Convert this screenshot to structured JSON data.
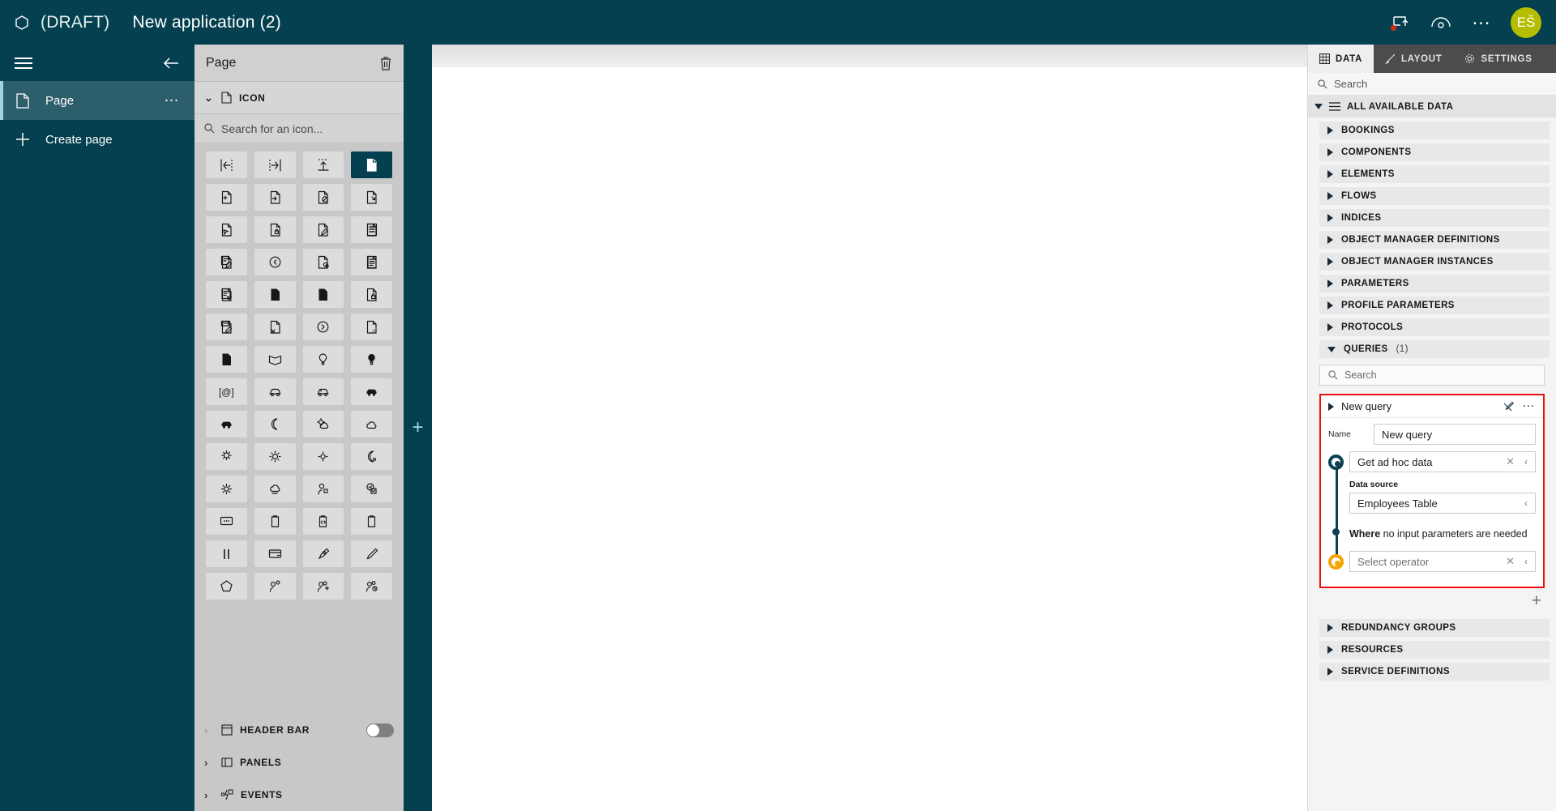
{
  "topbar": {
    "logo_icon": "hexagon-logo-icon",
    "draft_label": "(DRAFT)",
    "app_title": "New application (2)",
    "actions": [
      {
        "name": "publish-icon",
        "label": ""
      },
      {
        "name": "preview-eye-icon",
        "label": ""
      },
      {
        "name": "overflow-menu-icon",
        "label": "…"
      }
    ],
    "avatar_initials": "EŠ",
    "avatar_color": "#b5bd00",
    "background_color": "#04404f"
  },
  "sidebar": {
    "menu_icon": "hamburger-menu-icon",
    "back_icon": "back-arrow-icon",
    "items": [
      {
        "label": "Page",
        "icon": "document-icon",
        "selected": true,
        "more": "…"
      },
      {
        "label": "Create page",
        "icon": "plus-icon",
        "selected": false,
        "more": ""
      }
    ]
  },
  "panel2": {
    "title": "Page",
    "delete_icon": "trash-icon",
    "icon_section": {
      "label": "ICON",
      "icon": "document-icon",
      "expanded": true
    },
    "icon_search_placeholder": "Search for an icon...",
    "icons": [
      {
        "name": "align-left-icon",
        "glyph": "⋮←",
        "selected": false
      },
      {
        "name": "align-right-icon",
        "glyph": "→⋮",
        "selected": false
      },
      {
        "name": "align-top-icon",
        "glyph": "⤒",
        "selected": false
      },
      {
        "name": "document-icon",
        "glyph": "὜b",
        "selected": true
      },
      {
        "name": "document-add-icon",
        "glyph": "⊕",
        "selected": false
      },
      {
        "name": "document-forward-icon",
        "glyph": "→",
        "selected": false
      },
      {
        "name": "document-blocked-icon",
        "glyph": "⊘",
        "selected": false
      },
      {
        "name": "document-down-icon",
        "glyph": "↘",
        "selected": false
      },
      {
        "name": "document-cursor-icon",
        "glyph": "↖",
        "selected": false
      },
      {
        "name": "document-lock-icon",
        "glyph": "⚿",
        "selected": false
      },
      {
        "name": "document-edit-icon",
        "glyph": "✎",
        "selected": false
      },
      {
        "name": "document-list-icon",
        "glyph": "☰",
        "selected": false
      },
      {
        "name": "document-note-edit-icon",
        "glyph": "✏",
        "selected": false
      },
      {
        "name": "clock-back-icon",
        "glyph": "↺",
        "selected": false
      },
      {
        "name": "document-link-icon",
        "glyph": "⚭",
        "selected": false
      },
      {
        "name": "document-lines-icon",
        "glyph": "≡",
        "selected": false
      },
      {
        "name": "document-filter-icon",
        "glyph": "∇",
        "selected": false
      },
      {
        "name": "document-solid-lines-icon",
        "glyph": "▤",
        "selected": false
      },
      {
        "name": "document-filled-icon",
        "glyph": "▥",
        "selected": false
      },
      {
        "name": "document-lock2-icon",
        "glyph": "⚿",
        "selected": false
      },
      {
        "name": "document-pen-icon",
        "glyph": "✐",
        "selected": false
      },
      {
        "name": "document-close-icon",
        "glyph": "✕",
        "selected": false
      },
      {
        "name": "chevron-circle-right-icon",
        "glyph": "▶",
        "selected": false
      },
      {
        "name": "document-text-icon",
        "glyph": "A",
        "selected": false
      },
      {
        "name": "document-solid-icon",
        "glyph": "▮",
        "selected": false
      },
      {
        "name": "banner-icon",
        "glyph": "⬡",
        "selected": false
      },
      {
        "name": "balloon-icon",
        "glyph": "○",
        "selected": false
      },
      {
        "name": "balloon-filled-icon",
        "glyph": "●",
        "selected": false
      },
      {
        "name": "at-bracket-icon",
        "glyph": "[@]",
        "selected": false
      },
      {
        "name": "car-outline-icon",
        "glyph": "▱",
        "selected": false
      },
      {
        "name": "car-icon",
        "glyph": "▱",
        "selected": false
      },
      {
        "name": "car-filled-icon",
        "glyph": "▬",
        "selected": false
      },
      {
        "name": "car-solid-icon",
        "glyph": "▬",
        "selected": false
      },
      {
        "name": "moon-icon",
        "glyph": "☽",
        "selected": false
      },
      {
        "name": "sun-cloud-icon",
        "glyph": "⛅",
        "selected": false
      },
      {
        "name": "cloud-moon-icon",
        "glyph": "☁",
        "selected": false
      },
      {
        "name": "sun-rain-icon",
        "glyph": "☀",
        "selected": false
      },
      {
        "name": "sun-bright-icon",
        "glyph": "☀",
        "selected": false
      },
      {
        "name": "sun-small-icon",
        "glyph": "☀",
        "selected": false
      },
      {
        "name": "moon-crescent-icon",
        "glyph": "☾",
        "selected": false
      },
      {
        "name": "sun-rays-icon",
        "glyph": "☀",
        "selected": false
      },
      {
        "name": "cloud-wind-icon",
        "glyph": "☁",
        "selected": false
      },
      {
        "name": "person-lock-icon",
        "glyph": "☺",
        "selected": false
      },
      {
        "name": "check-badges-icon",
        "glyph": "✓",
        "selected": false
      },
      {
        "name": "chat-dots-icon",
        "glyph": "…",
        "selected": false
      },
      {
        "name": "clipboard-icon",
        "glyph": "Ὄb",
        "selected": false
      },
      {
        "name": "clipboard-code-icon",
        "glyph": "</>",
        "selected": false
      },
      {
        "name": "clipboard-text-icon",
        "glyph": "A",
        "selected": false
      },
      {
        "name": "pause-icon",
        "glyph": "‖",
        "selected": false
      },
      {
        "name": "credit-card-icon",
        "glyph": "▭",
        "selected": false
      },
      {
        "name": "pen-nib-icon",
        "glyph": "✒",
        "selected": false
      },
      {
        "name": "pencil-icon",
        "glyph": "✎",
        "selected": false
      },
      {
        "name": "pentagon-icon",
        "glyph": "⬠",
        "selected": false
      },
      {
        "name": "person-add-small-icon",
        "glyph": "☺",
        "selected": false
      },
      {
        "name": "people-add-icon",
        "glyph": "☺",
        "selected": false
      },
      {
        "name": "people-time-icon",
        "glyph": "☺",
        "selected": false
      }
    ],
    "sections": [
      {
        "label": "HEADER BAR",
        "icon": "header-bar-icon",
        "expanded": false,
        "has_toggle": true,
        "toggle_on": false
      },
      {
        "label": "PANELS",
        "icon": "panels-icon",
        "expanded": false,
        "has_toggle": false,
        "toggle_on": false
      },
      {
        "label": "EVENTS",
        "icon": "events-icon",
        "expanded": false,
        "has_toggle": false,
        "toggle_on": false
      }
    ]
  },
  "strip": {
    "add_label": "+"
  },
  "right_panel": {
    "tabs": [
      {
        "label": "DATA",
        "icon": "table-icon",
        "active": true
      },
      {
        "label": "LAYOUT",
        "icon": "brush-icon",
        "active": false
      },
      {
        "label": "SETTINGS",
        "icon": "gear-icon",
        "active": false
      }
    ],
    "search_placeholder": "Search",
    "all_data_label": "ALL AVAILABLE DATA",
    "all_data_icon": "list-icon",
    "categories_before": [
      {
        "label": "BOOKINGS",
        "count": ""
      },
      {
        "label": "COMPONENTS",
        "count": ""
      },
      {
        "label": "ELEMENTS",
        "count": ""
      },
      {
        "label": "FLOWS",
        "count": ""
      },
      {
        "label": "INDICES",
        "count": ""
      },
      {
        "label": "OBJECT MANAGER DEFINITIONS",
        "count": ""
      },
      {
        "label": "OBJECT MANAGER INSTANCES",
        "count": ""
      },
      {
        "label": "PARAMETERS",
        "count": ""
      },
      {
        "label": "PROFILE PARAMETERS",
        "count": ""
      },
      {
        "label": "PROTOCOLS",
        "count": ""
      }
    ],
    "queries_section": {
      "label": "QUERIES",
      "count": "(1)",
      "expanded": true,
      "search_placeholder": "Search",
      "card": {
        "title": "New query",
        "disconnect_icon": "unlink-pen-icon",
        "more_icon": "overflow-menu-icon",
        "name_label": "Name",
        "name_value": "New query",
        "action_value": "Get ad hoc data",
        "data_source_label": "Data source",
        "data_source_value": "Employees Table",
        "where_bold": "Where",
        "where_rest": " no input parameters are needed",
        "operator_placeholder": "Select operator",
        "clear_icon": "✕",
        "expand_icon": "‹",
        "highlight_color": "#ef0f0f",
        "step_color": "#0b4152",
        "warning_color": "#f4a300"
      },
      "add_query_label": "+"
    },
    "categories_after": [
      {
        "label": "REDUNDANCY GROUPS",
        "count": ""
      },
      {
        "label": "RESOURCES",
        "count": ""
      },
      {
        "label": "SERVICE DEFINITIONS",
        "count": ""
      }
    ]
  }
}
